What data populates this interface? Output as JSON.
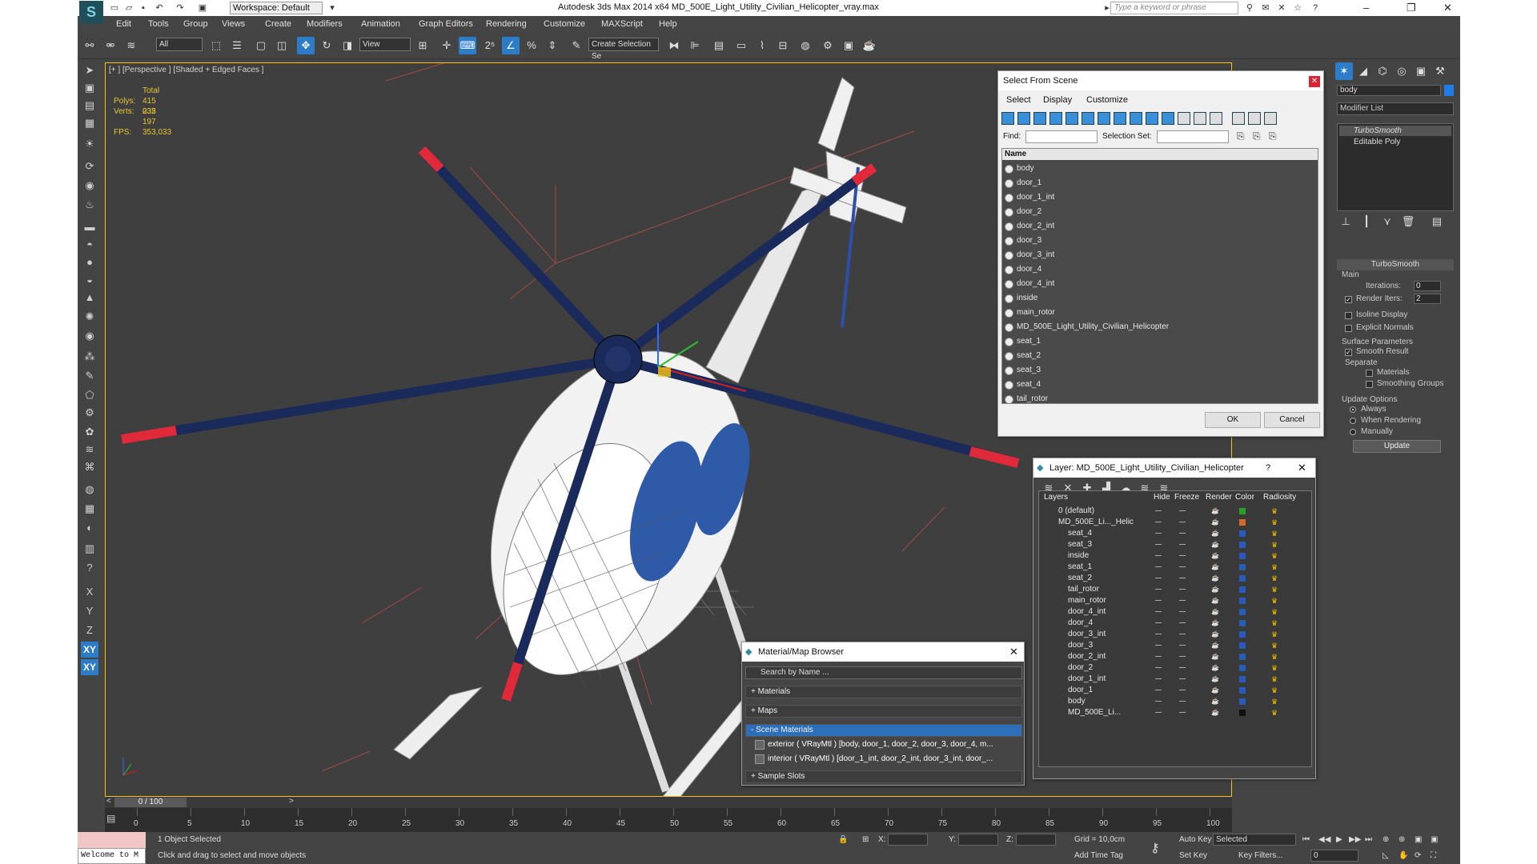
{
  "titlebar": {
    "workspace": "Workspace: Default",
    "title": "Autodesk 3ds Max  2014 x64     MD_500E_Light_Utility_Civilian_Helicopter_vray.max",
    "search_placeholder": "Type a keyword or phrase"
  },
  "menu": [
    "Edit",
    "Tools",
    "Group",
    "Views",
    "Create",
    "Modifiers",
    "Animation",
    "Graph Editors",
    "Rendering",
    "Customize",
    "MAXScript",
    "Help"
  ],
  "toolbar": {
    "filter": "All",
    "refcoord": "View",
    "selection_set": "Create Selection Se"
  },
  "viewport": {
    "label": "[+ ] [Perspective ] [Shaded + Edged Faces ]",
    "stats": {
      "total_label": "Total",
      "polys_label": "Polys:",
      "polys": "415 035",
      "verts_label": "Verts:",
      "verts": "232 197",
      "fps_label": "FPS:",
      "fps": "353,033"
    }
  },
  "left_toolbar": {
    "x": "X",
    "y": "Y",
    "z": "Z",
    "xy": "XY",
    "xy2": "XY"
  },
  "select_from_scene": {
    "title": "Select From Scene",
    "menu": [
      "Select",
      "Display",
      "Customize"
    ],
    "find_label": "Find:",
    "selset_label": "Selection Set:",
    "column": "Name",
    "items": [
      "body",
      "door_1",
      "door_1_int",
      "door_2",
      "door_2_int",
      "door_3",
      "door_3_int",
      "door_4",
      "door_4_int",
      "inside",
      "main_rotor",
      "MD_500E_Light_Utility_Civilian_Helicopter",
      "seat_1",
      "seat_2",
      "seat_3",
      "seat_4",
      "tail_rotor"
    ],
    "ok": "OK",
    "cancel": "Cancel"
  },
  "layers": {
    "title": "Layer: MD_500E_Light_Utility_Civilian_Helicopter",
    "help": "?",
    "columns": [
      "Layers",
      "Hide",
      "Freeze",
      "Render",
      "Color",
      "Radiosity"
    ],
    "rows": [
      {
        "name": "0 (default)",
        "color": "#2aa02a"
      },
      {
        "name": "MD_500E_Li..._Helic",
        "color": "#d26a2a"
      },
      {
        "name": "seat_4",
        "color": "#2a5ab8"
      },
      {
        "name": "seat_3",
        "color": "#2a5ab8"
      },
      {
        "name": "inside",
        "color": "#2a5ab8"
      },
      {
        "name": "seat_1",
        "color": "#2a5ab8"
      },
      {
        "name": "seat_2",
        "color": "#2a5ab8"
      },
      {
        "name": "tail_rotor",
        "color": "#2a5ab8"
      },
      {
        "name": "main_rotor",
        "color": "#2a5ab8"
      },
      {
        "name": "door_4_int",
        "color": "#2a5ab8"
      },
      {
        "name": "door_4",
        "color": "#2a5ab8"
      },
      {
        "name": "door_3_int",
        "color": "#2a5ab8"
      },
      {
        "name": "door_3",
        "color": "#2a5ab8"
      },
      {
        "name": "door_2_int",
        "color": "#2a5ab8"
      },
      {
        "name": "door_2",
        "color": "#2a5ab8"
      },
      {
        "name": "door_1_int",
        "color": "#2a5ab8"
      },
      {
        "name": "door_1",
        "color": "#2a5ab8"
      },
      {
        "name": "body",
        "color": "#2a5ab8"
      },
      {
        "name": "MD_500E_Li...",
        "color": "#111111"
      }
    ]
  },
  "material_browser": {
    "title": "Material/Map Browser",
    "search": "Search by Name ...",
    "groups": {
      "materials": "+ Materials",
      "maps": "+ Maps",
      "scene": "- Scene Materials",
      "samples": "+ Sample Slots"
    },
    "scene_items": [
      "exterior  ( VRayMtl )  [body, door_1, door_2, door_3, door_4, m...",
      "interior  ( VRayMtl )  [door_1_int, door_2_int, door_3_int, door_..."
    ]
  },
  "command_panel": {
    "object_name": "body",
    "modifier_list": "Modifier List",
    "stack": [
      "TurboSmooth",
      "Editable Poly"
    ],
    "rollout": "TurboSmooth",
    "main": "Main",
    "iterations_label": "Iterations:",
    "iterations": "0",
    "render_iters_label": "Render Iters:",
    "render_iters": "2",
    "isoline": "Isoline Display",
    "explicit": "Explicit Normals",
    "surface": "Surface Parameters",
    "smooth_result": "Smooth Result",
    "separate": "Separate",
    "materials": "Materials",
    "smoothing_groups": "Smoothing Groups",
    "update_options": "Update Options",
    "always": "Always",
    "when_rendering": "When Rendering",
    "manually": "Manually",
    "update": "Update"
  },
  "timeline": {
    "frame": "0 / 100",
    "ticks": [
      "0",
      "5",
      "10",
      "15",
      "20",
      "25",
      "30",
      "35",
      "40",
      "45",
      "50",
      "55",
      "60",
      "65",
      "70",
      "75",
      "80",
      "85",
      "90",
      "95",
      "100"
    ]
  },
  "status": {
    "maxscript": "Welcome to M",
    "selected": "1 Object Selected",
    "prompt": "Click and drag to select and move objects",
    "x_label": "X:",
    "y_label": "Y:",
    "z_label": "Z:",
    "grid": "Grid = 10,0cm",
    "add_time_tag": "Add Time Tag",
    "auto_key": "Auto Key",
    "set_key": "Set Key",
    "selected_dd": "Selected",
    "key_filters": "Key Filters...",
    "frame": "0"
  },
  "colors": {
    "accent": "#2d7cc8",
    "viewport_border": "#f5c518",
    "stats": "#e6c531"
  }
}
